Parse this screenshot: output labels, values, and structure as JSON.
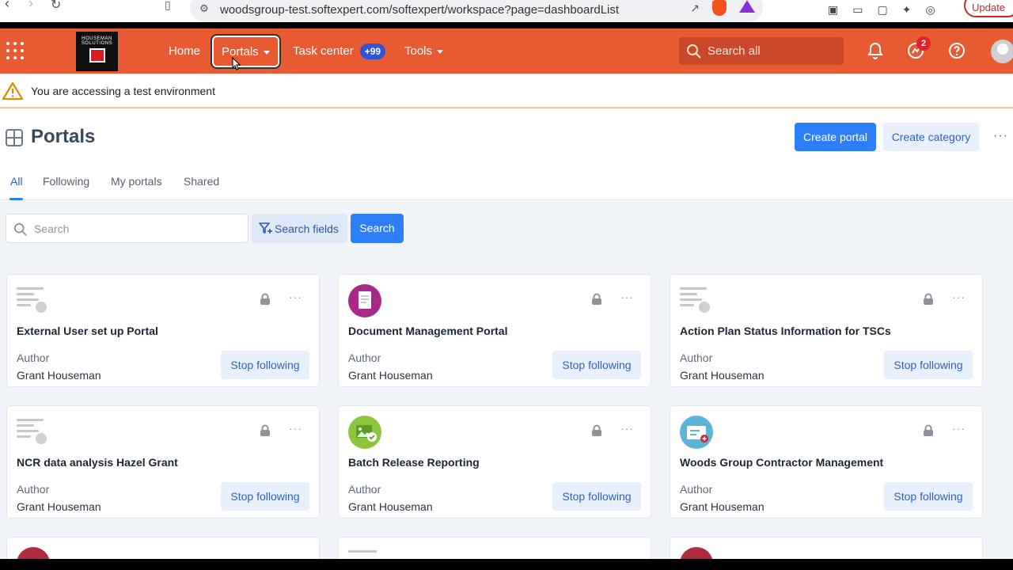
{
  "browser": {
    "url": "woodsgroup-test.softexpert.com/softexpert/workspace?page=dashboardList",
    "update_label": "Update"
  },
  "header": {
    "logo_text": "HOUSEMAN SOLUTIONS",
    "nav": [
      {
        "label": "Home"
      },
      {
        "label": "Portals"
      },
      {
        "label": "Task center",
        "badge": "+99"
      },
      {
        "label": "Tools"
      }
    ],
    "search_placeholder": "Search all",
    "notification_count": "2",
    "colors": {
      "header": "#e85a32",
      "accent": "#2d7ff9"
    }
  },
  "warning": {
    "text": "You are accessing a test environment"
  },
  "page": {
    "title": "Portals",
    "create_portal": "Create portal",
    "create_category": "Create category",
    "tabs": [
      "All",
      "Following",
      "My portals",
      "Shared"
    ],
    "active_tab": "All"
  },
  "filters": {
    "search_placeholder": "Search",
    "search_fields": "Search fields",
    "search_button": "Search"
  },
  "portals": [
    {
      "title": "External User set up Portal",
      "author_label": "Author",
      "author": "Grant Houseman",
      "action": "Stop following",
      "icon": "document-icon"
    },
    {
      "title": "Document Management Portal",
      "author_label": "Author",
      "author": "Grant Houseman",
      "action": "Stop following",
      "icon": "document-circle-icon"
    },
    {
      "title": "Action Plan Status Information for TSCs",
      "author_label": "Author",
      "author": "Grant Houseman",
      "action": "Stop following",
      "icon": "document-icon"
    },
    {
      "title": "NCR data analysis Hazel Grant",
      "author_label": "Author",
      "author": "Grant Houseman",
      "action": "Stop following",
      "icon": "document-icon"
    },
    {
      "title": "Batch Release Reporting",
      "author_label": "Author",
      "author": "Grant Houseman",
      "action": "Stop following",
      "icon": "image-check-icon"
    },
    {
      "title": "Woods Group Contractor Management",
      "author_label": "Author",
      "author": "Grant Houseman",
      "action": "Stop following",
      "icon": "id-card-icon"
    }
  ]
}
